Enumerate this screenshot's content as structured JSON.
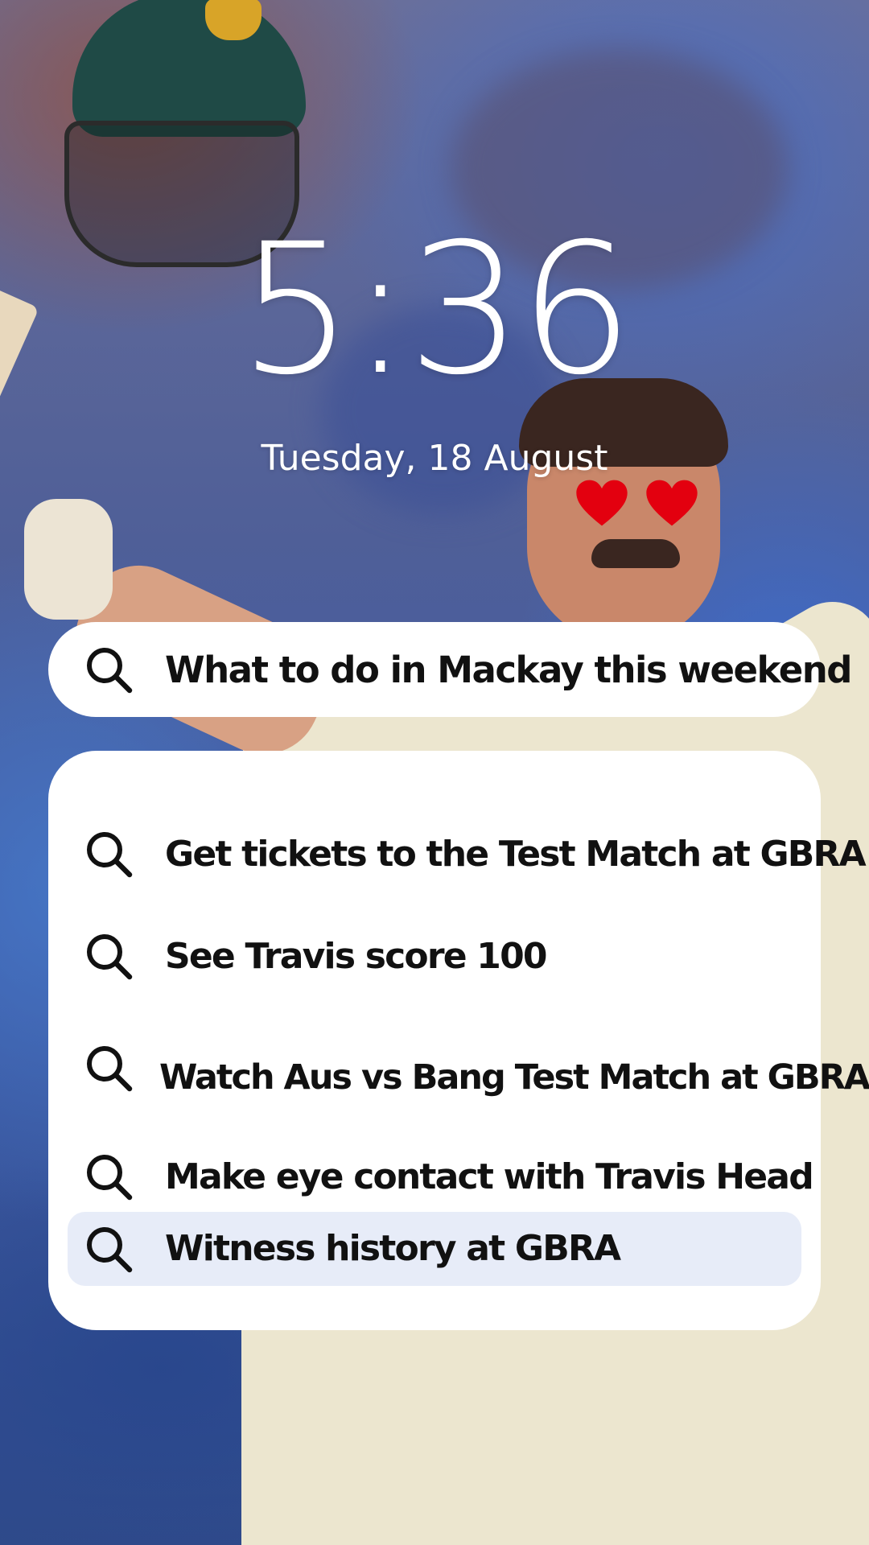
{
  "lock_screen": {
    "time": "5:36",
    "date": "Tuesday, 18 August"
  },
  "search_bar": {
    "icon": "search-icon",
    "query": "What to do in Mackay this weekend"
  },
  "suggestions": [
    {
      "icon": "search-icon",
      "label": "Get tickets to the Test Match at GBRA"
    },
    {
      "icon": "search-icon",
      "label": "See Travis score 100"
    },
    {
      "icon": "search-icon",
      "label": "Watch Aus vs Bang Test Match at GBRA"
    },
    {
      "icon": "search-icon",
      "label": "Make eye contact with Travis Head"
    },
    {
      "icon": "search-icon",
      "label": "Witness history at GBRA",
      "highlighted": true
    }
  ],
  "colors": {
    "card_background": "#ffffff",
    "highlight_background": "#e7ecf8",
    "text": "#111111",
    "heart": "#e3000f"
  }
}
